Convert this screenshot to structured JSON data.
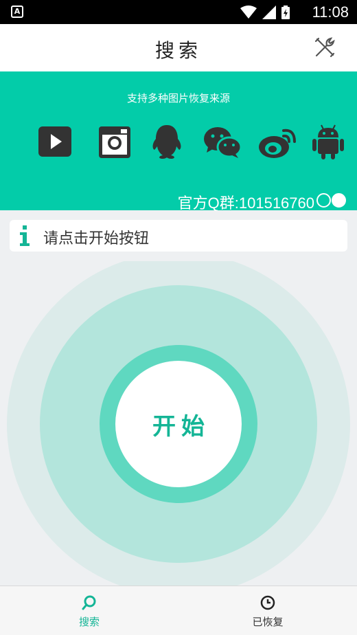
{
  "status_bar": {
    "time": "11:08",
    "app_icon": "A"
  },
  "header": {
    "title": "搜索"
  },
  "banner": {
    "subtitle": "支持多种图片恢复来源",
    "sources": [
      "youtube-icon",
      "instagram-icon",
      "qq-icon",
      "wechat-icon",
      "weibo-icon",
      "android-icon"
    ],
    "qq_group": "官方Q群:101516760",
    "pager": {
      "count": 2,
      "active": 2
    }
  },
  "hint": {
    "text": "请点击开始按钮"
  },
  "main": {
    "start_label": "开始"
  },
  "bottom_nav": {
    "items": [
      {
        "label": "搜索",
        "icon": "search-icon",
        "active": true
      },
      {
        "label": "已恢复",
        "icon": "clock-icon",
        "active": false
      }
    ]
  },
  "colors": {
    "accent": "#03cca9",
    "active_tab": "#14b596",
    "ring_light": "#c9ebe5",
    "ring_mid": "#b4e6de",
    "ring_strong": "#5fd8c0"
  }
}
